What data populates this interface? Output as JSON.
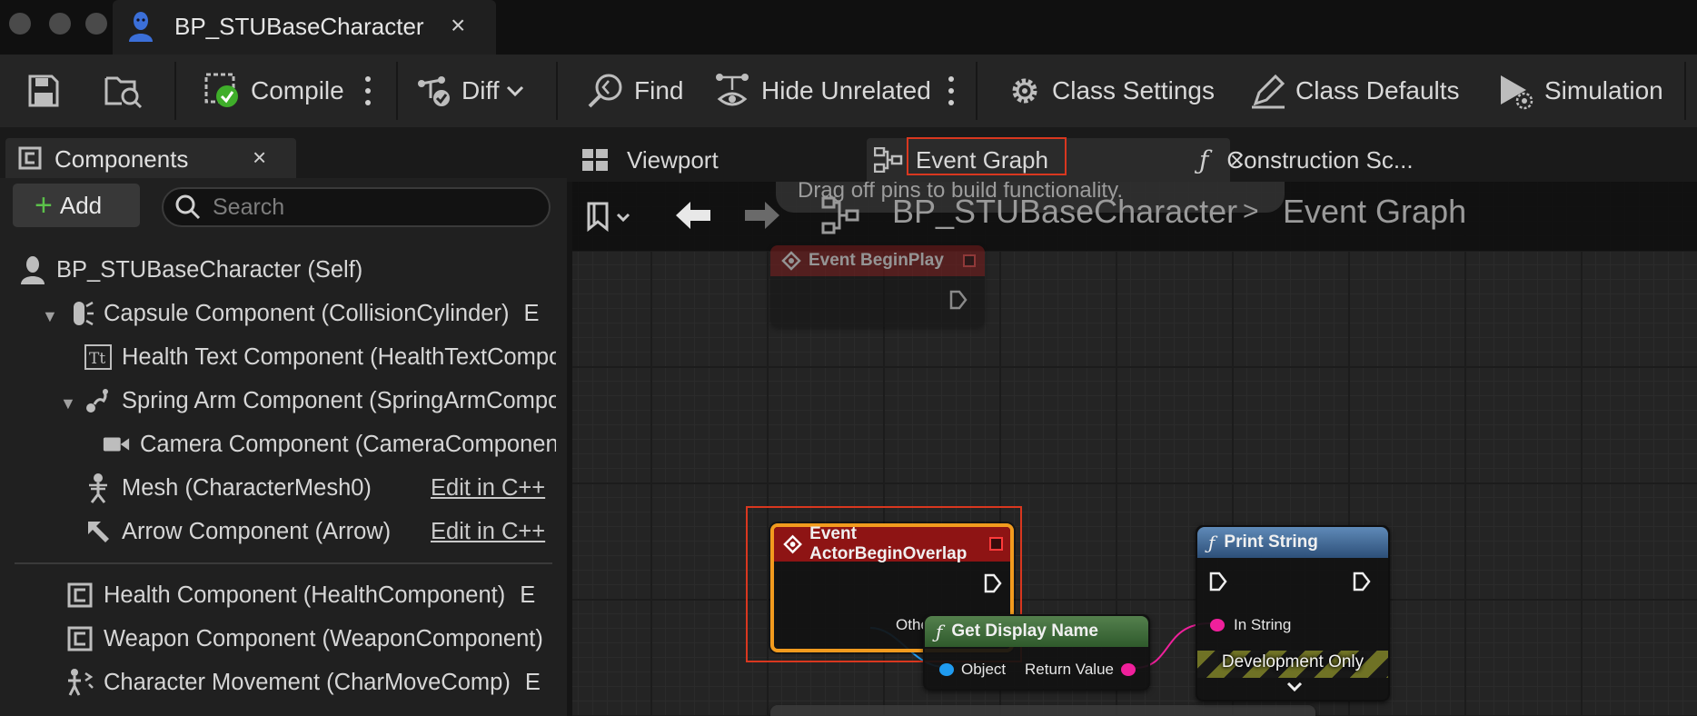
{
  "window": {
    "tab_title": "BP_STUBaseCharacter",
    "tab_close": "×"
  },
  "toolbar": {
    "compile": "Compile",
    "diff": "Diff",
    "find": "Find",
    "hide_unrelated": "Hide Unrelated",
    "class_settings": "Class Settings",
    "class_defaults": "Class Defaults",
    "simulation": "Simulation"
  },
  "components_panel": {
    "title": "Components",
    "close": "×",
    "add_label": "Add",
    "search_placeholder": "Search",
    "items": [
      {
        "label": "BP_STUBaseCharacter (Self)"
      },
      {
        "label": "Capsule Component (CollisionCylinder)",
        "suffix": "E"
      },
      {
        "label": "Health Text Component (HealthTextComponent)"
      },
      {
        "label": "Spring Arm Component (SpringArmComponent)"
      },
      {
        "label": "Camera Component (CameraComponent)"
      },
      {
        "label": "Mesh (CharacterMesh0)",
        "edit": "Edit in C++"
      },
      {
        "label": "Arrow Component (Arrow)",
        "edit": "Edit in C++"
      },
      {
        "label": "Health Component (HealthComponent)",
        "suffix": "E"
      },
      {
        "label": "Weapon Component (WeaponComponent)"
      },
      {
        "label": "Character Movement (CharMoveComp)",
        "suffix": "E"
      }
    ]
  },
  "graph_tabs": {
    "viewport": "Viewport",
    "event_graph": "Event Graph",
    "event_graph_close": "×",
    "construction": "Construction Sc..."
  },
  "graph": {
    "hint": "Drag off pins to build functionality.",
    "breadcrumb_root": "BP_STUBaseCharacter",
    "breadcrumb_sep": ">",
    "breadcrumb_current": "Event Graph",
    "nodes": {
      "begin_play": {
        "title": "Event BeginPlay"
      },
      "actor_begin_overlap": {
        "title": "Event ActorBeginOverlap",
        "pin_other_actor": "Other Actor"
      },
      "get_display_name": {
        "title": "Get Display Name",
        "pin_object": "Object",
        "pin_return": "Return Value"
      },
      "print_string": {
        "title": "Print String",
        "pin_in_string": "In String",
        "footer": "Development Only"
      }
    }
  },
  "colors": {
    "event_header": "#8e1414",
    "pure_function_header": "#3f6c3b",
    "function_header": "#3d5d84",
    "object_pin": "#1f9bf0",
    "string_pin": "#f0209c",
    "highlight": "#d9371f",
    "selection": "#f29b1e"
  }
}
